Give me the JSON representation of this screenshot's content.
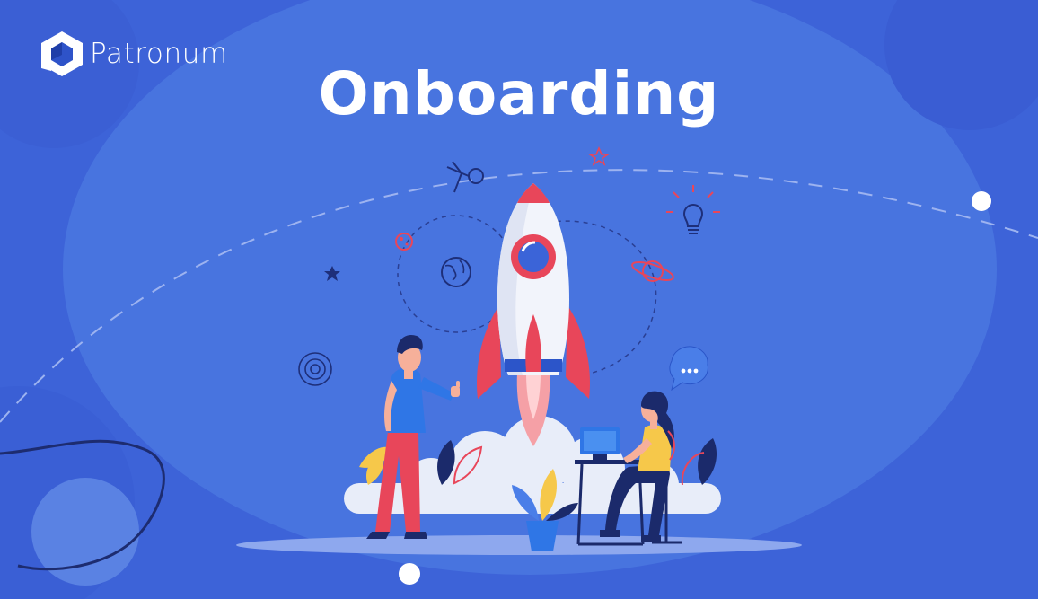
{
  "brand": {
    "name": "Patronum",
    "logo_icon": "hexagon-cube-logo"
  },
  "hero": {
    "title": "Onboarding"
  },
  "illustration": {
    "subject": "rocket-launch-icon",
    "elements": [
      "rocket-icon",
      "man-thumbs-up-icon",
      "woman-at-laptop-icon",
      "lightbulb-icon",
      "planet-icon",
      "globe-icon",
      "chat-bubble-icon",
      "satellite-icon",
      "star-icon",
      "plant-icon"
    ]
  },
  "colors": {
    "background": "#3d63d8",
    "blob": "#4a74e0",
    "accent_red": "#e8465a",
    "white": "#ffffff",
    "dark_navy": "#1b2a6b"
  }
}
